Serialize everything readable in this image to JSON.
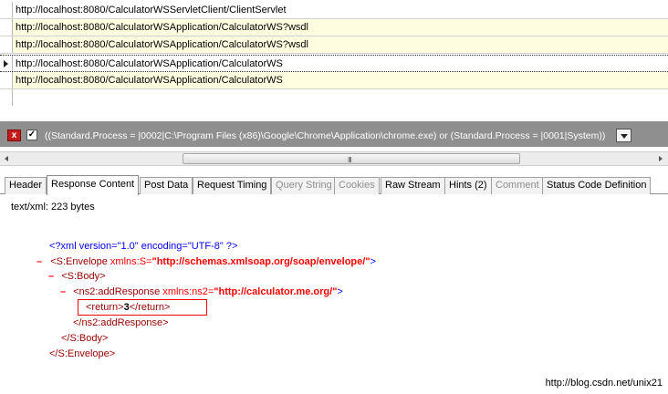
{
  "sessions": [
    {
      "url": "http://localhost:8080/CalculatorWSServletClient/ClientServlet",
      "alt": false
    },
    {
      "url": "http://localhost:8080/CalculatorWSApplication/CalculatorWS?wsdl",
      "alt": true
    },
    {
      "url": "http://localhost:8080/CalculatorWSApplication/CalculatorWS?wsdl",
      "alt": true
    },
    {
      "url": "http://localhost:8080/CalculatorWSApplication/CalculatorWS",
      "alt": false,
      "selected": true
    },
    {
      "url": "http://localhost:8080/CalculatorWSApplication/CalculatorWS",
      "alt": true
    }
  ],
  "filter": {
    "close_glyph": "x",
    "check_glyph": "✓",
    "checked": true,
    "text": "((Standard.Process = |0002|C:\\Program Files (x86)\\Google\\Chrome\\Application\\chrome.exe) or (Standard.Process = |0001|System))"
  },
  "scrollbar": {
    "grip": "III"
  },
  "tabs": [
    {
      "label": "Header",
      "state": "normal"
    },
    {
      "label": "Response Content",
      "state": "active"
    },
    {
      "label": "Post Data",
      "state": "normal"
    },
    {
      "label": "Request Timing",
      "state": "normal"
    },
    {
      "label": "Query String",
      "state": "disabled"
    },
    {
      "label": "Cookies",
      "state": "disabled"
    },
    {
      "label": "Raw Stream",
      "state": "normal"
    },
    {
      "label": "Hints (2)",
      "state": "normal"
    },
    {
      "label": "Comment",
      "state": "disabled"
    },
    {
      "label": "Status Code Definition",
      "state": "normal"
    }
  ],
  "response": {
    "content_type": "text/xml: 223 bytes",
    "collapse_glyph": "–",
    "xml_decl": "<?xml version=\"1.0\" encoding=\"UTF-8\" ?>",
    "envelope_open_tag": "<S:Envelope",
    "envelope_attr_name": " xmlns:S=",
    "envelope_attr_value": "\"http://schemas.xmlsoap.org/soap/envelope/\"",
    "envelope_close_bracket": ">",
    "body_open": "<S:Body>",
    "add_response_open_tag": "<ns2:addResponse",
    "add_response_attr_name": " xmlns:ns2=",
    "add_response_attr_value": "\"http://calculator.me.org/\"",
    "add_response_close_bracket": ">",
    "return_open": "<return>",
    "return_value": "3",
    "return_close": "</return>",
    "add_response_close": "</ns2:addResponse>",
    "body_close": "</S:Body>",
    "envelope_close": "</S:Envelope>"
  },
  "watermark": "http://blog.csdn.net/unix21",
  "colors": {
    "xml_markup": "#0000ff",
    "xml_tag_name": "#990000",
    "xml_attr_value": "#ff0000",
    "highlight_box": "#ff0000",
    "filter_bar": "#8f8f8f",
    "alt_row": "#fffde0"
  }
}
